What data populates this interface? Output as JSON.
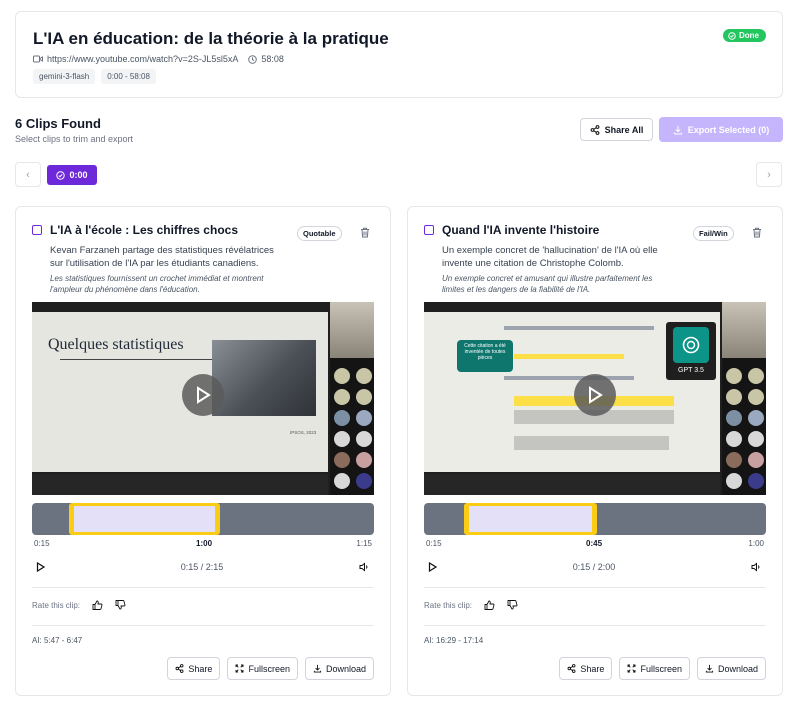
{
  "header": {
    "title": "L'IA en éducation: de la théorie à la pratique",
    "url": "https://www.youtube.com/watch?v=2S-JL5sl5xA",
    "duration": "58:08",
    "tags": [
      "gemini-3-flash",
      "0:00 - 58:08"
    ],
    "status": "Done",
    "status_color": "#22c55e"
  },
  "summary": {
    "title": "6 Clips Found",
    "subtitle": "Select clips to trim and export",
    "share_all": "Share All",
    "export": "Export Selected (0)",
    "accent": "#6d28d9"
  },
  "timeline_nav": {
    "time": "0:00"
  },
  "clips": [
    {
      "title": "L'IA à l'école : Les chiffres chocs",
      "badge": "Quotable",
      "desc_1": "Kevan Farzaneh partage des statistiques révélatrices",
      "desc_2": "sur l'utilisation de l'IA par les étudiants canadiens.",
      "ai_1": "Les statistiques fournissent un crochet immédiat et montrent",
      "ai_2": "l'ampleur du phénomène dans l'éducation.",
      "slide_heading": "Quelques statistiques",
      "slide_footer": "IPSOS, 2023",
      "tick_start": "0:15",
      "tick_mid": "1:00",
      "tick_end": "1:15",
      "time": "0:15 / 2:15",
      "rate": "Rate this clip:",
      "ai_time": "AI: 5:47 - 6:47",
      "selection_start": 0.107,
      "selection_end": 0.55
    },
    {
      "title": "Quand l'IA invente l'histoire",
      "badge": "Fail/Win",
      "desc_1": "Un exemple concret de 'hallucination' de l'IA où elle",
      "desc_2": "invente une citation de Christophe Colomb.",
      "ai_1": "Un exemple concret et amusant qui illustre parfaitement les",
      "ai_2": "limites et les dangers de la fiabilité de l'IA.",
      "slide_bubble": "Cette citation a été inventée de toutes pièces",
      "slide_gpt": "GPT 3.5",
      "tick_start": "0:15",
      "tick_mid": "0:45",
      "tick_end": "1:00",
      "time": "0:15 / 2:00",
      "rate": "Rate this clip:",
      "ai_time": "AI: 16:29 - 17:14",
      "selection_start": 0.118,
      "selection_end": 0.505
    }
  ],
  "actions": {
    "share": "Share",
    "fullscreen": "Fullscreen",
    "download": "Download"
  }
}
